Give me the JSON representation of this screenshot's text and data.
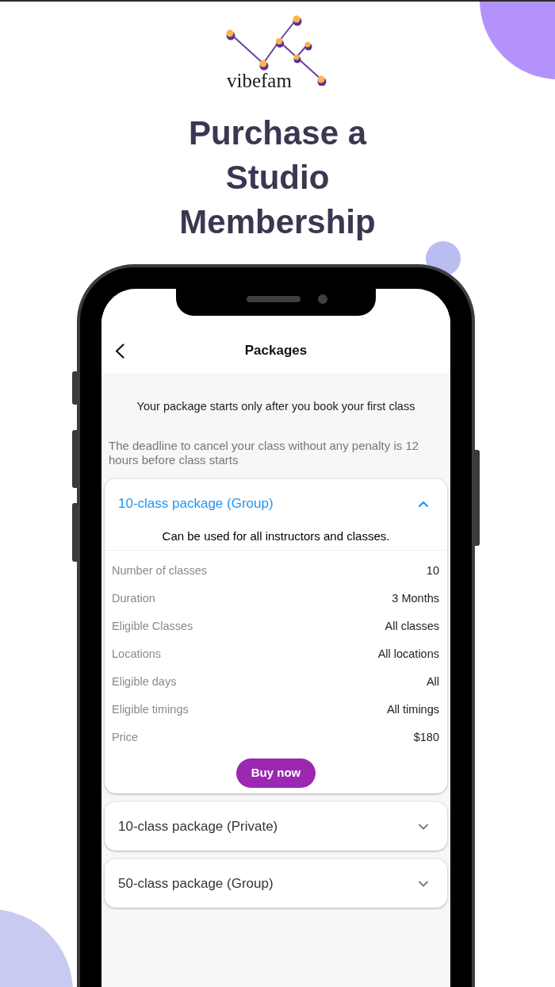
{
  "brand": {
    "name": "vibefam"
  },
  "headline": "Purchase a Studio Membership",
  "phone": {
    "header": {
      "title": "Packages"
    },
    "start_notice": "Your package starts only after you book your first class",
    "cancellation_notice": "The deadline to cancel your class without any penalty is 12 hours before class starts",
    "packages": [
      {
        "title": "10-class package (Group)",
        "expanded": true,
        "description": "Can be used for all instructors and classes.",
        "details": [
          {
            "label": "Number of classes",
            "value": "10"
          },
          {
            "label": "Duration",
            "value": "3 Months"
          },
          {
            "label": "Eligible Classes",
            "value": "All classes"
          },
          {
            "label": "Locations",
            "value": "All locations"
          },
          {
            "label": "Eligible days",
            "value": "All"
          },
          {
            "label": "Eligible timings",
            "value": "All timings"
          },
          {
            "label": "Price",
            "value": "$180"
          }
        ],
        "action": "Buy now"
      },
      {
        "title": "10-class package (Private)",
        "expanded": false
      },
      {
        "title": "50-class package (Group)",
        "expanded": false
      }
    ]
  }
}
